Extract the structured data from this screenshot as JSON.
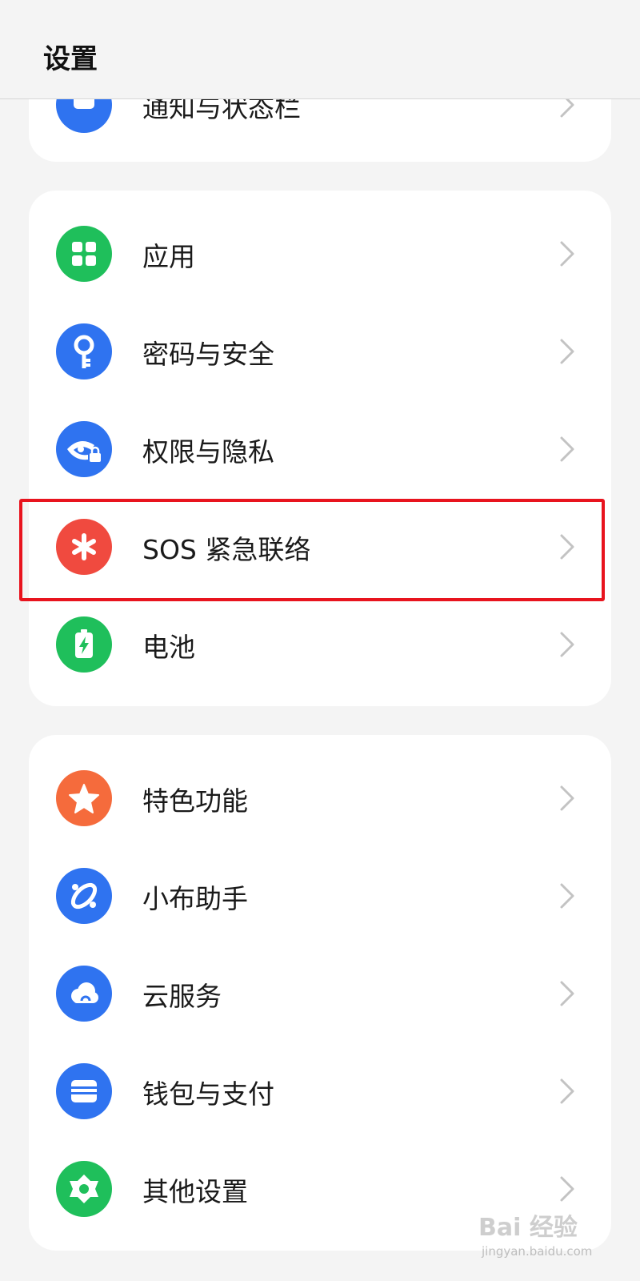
{
  "header": {
    "title": "设置"
  },
  "card0": {
    "items": [
      {
        "label": "通知与状态栏",
        "icon": "notification-icon",
        "color": "#2f73f0"
      }
    ]
  },
  "card1": {
    "items": [
      {
        "label": "应用",
        "icon": "apps-grid-icon",
        "color": "#1fbf5b"
      },
      {
        "label": "密码与安全",
        "icon": "key-icon",
        "color": "#2f73f0"
      },
      {
        "label": "权限与隐私",
        "icon": "privacy-eye-lock-icon",
        "color": "#2f73f0"
      },
      {
        "label": "SOS 紧急联络",
        "icon": "sos-asterisk-icon",
        "color": "#f04a3f"
      },
      {
        "label": "电池",
        "icon": "battery-icon",
        "color": "#1fbf5b"
      }
    ]
  },
  "card2": {
    "items": [
      {
        "label": "特色功能",
        "icon": "star-icon",
        "color": "#f56b3c"
      },
      {
        "label": "小布助手",
        "icon": "assistant-icon",
        "color": "#2f73f0"
      },
      {
        "label": "云服务",
        "icon": "cloud-icon",
        "color": "#2f73f0"
      },
      {
        "label": "钱包与支付",
        "icon": "wallet-icon",
        "color": "#2f73f0"
      },
      {
        "label": "其他设置",
        "icon": "gear-icon",
        "color": "#1fbf5b"
      }
    ]
  },
  "watermark": {
    "brand": "Bai 经验",
    "url": "jingyan.baidu.com"
  }
}
